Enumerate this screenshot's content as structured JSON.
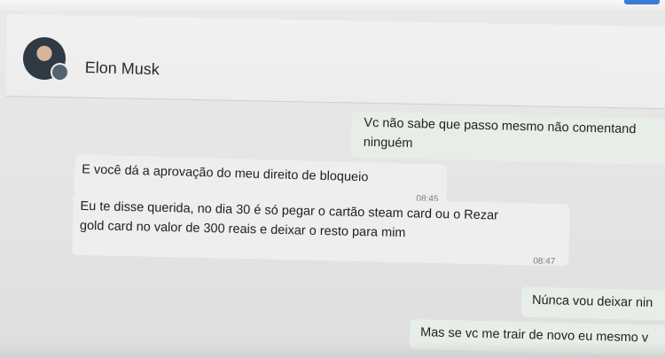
{
  "theme": {
    "accent": "#3a7bd5"
  },
  "header": {
    "contact_name": "Elon Musk",
    "avatar_icon": "profile-photo",
    "status_icon": "status-ring-icon"
  },
  "messages": [
    {
      "direction": "outgoing",
      "lines": [
        "Vc não  sabe que passo  mesmo não  comentand",
        "ninguém"
      ]
    },
    {
      "direction": "incoming",
      "lines": [
        "E você dá a aprovação do meu direito de bloqueio"
      ],
      "time": "08:45"
    },
    {
      "direction": "incoming",
      "lines": [
        "Eu te disse querida, no dia 30 é só pegar o cartão steam card ou o Rezar",
        "gold card no valor de 300 reais e deixar o resto para mim"
      ],
      "time": "08:47"
    },
    {
      "direction": "outgoing",
      "lines": [
        "Núnca  vou deixar nin"
      ]
    },
    {
      "direction": "outgoing",
      "lines": [
        "Mas se vc me trair de novo eu mesmo  v"
      ]
    }
  ]
}
